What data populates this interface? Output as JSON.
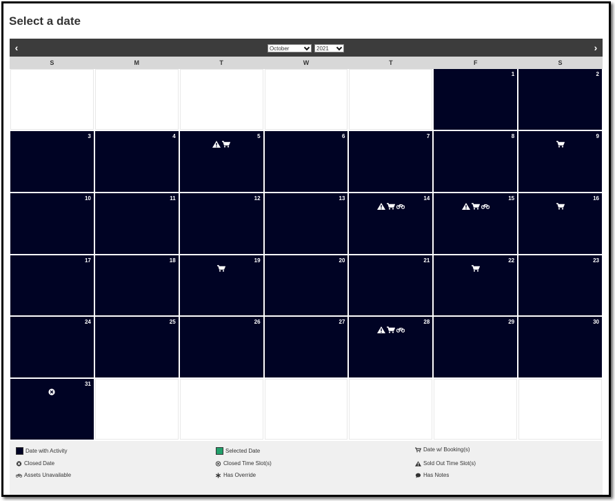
{
  "page": {
    "title": "Select a date"
  },
  "nav": {
    "prev": "‹",
    "next": "›",
    "month": "October",
    "year": "2021"
  },
  "weekdays": [
    "S",
    "M",
    "T",
    "W",
    "T",
    "F",
    "S"
  ],
  "days": {
    "1": "1",
    "2": "2",
    "3": "3",
    "4": "4",
    "5": "5",
    "6": "6",
    "7": "7",
    "8": "8",
    "9": "9",
    "10": "10",
    "11": "11",
    "12": "12",
    "13": "13",
    "14": "14",
    "15": "15",
    "16": "16",
    "17": "17",
    "18": "18",
    "19": "19",
    "20": "20",
    "21": "21",
    "22": "22",
    "23": "23",
    "24": "24",
    "25": "25",
    "26": "26",
    "27": "27",
    "28": "28",
    "29": "29",
    "30": "30",
    "31": "31"
  },
  "day_icons": {
    "5": [
      "warning-icon",
      "cart-icon"
    ],
    "9": [
      "cart-icon"
    ],
    "14": [
      "warning-icon",
      "cart-icon",
      "bike-icon"
    ],
    "15": [
      "warning-icon",
      "cart-icon",
      "bike-icon"
    ],
    "16": [
      "cart-icon"
    ],
    "19": [
      "cart-icon"
    ],
    "22": [
      "cart-icon"
    ],
    "28": [
      "warning-icon",
      "cart-icon",
      "bike-icon"
    ],
    "31": [
      "closed-icon"
    ]
  },
  "colors": {
    "activity": "#000324",
    "selected": "#22a06b",
    "navbar": "#3c3c3c"
  },
  "legend": {
    "activity": "Date with Activity",
    "selected": "Selected Date",
    "booking": "Date w/ Booking(s)",
    "closed_date": "Closed Date",
    "closed_slot": "Closed Time Slot(s)",
    "sold_out": "Sold Out Time Slot(s)",
    "assets": "Assets Unavailable",
    "override": "Has Override",
    "notes": "Has Notes"
  }
}
